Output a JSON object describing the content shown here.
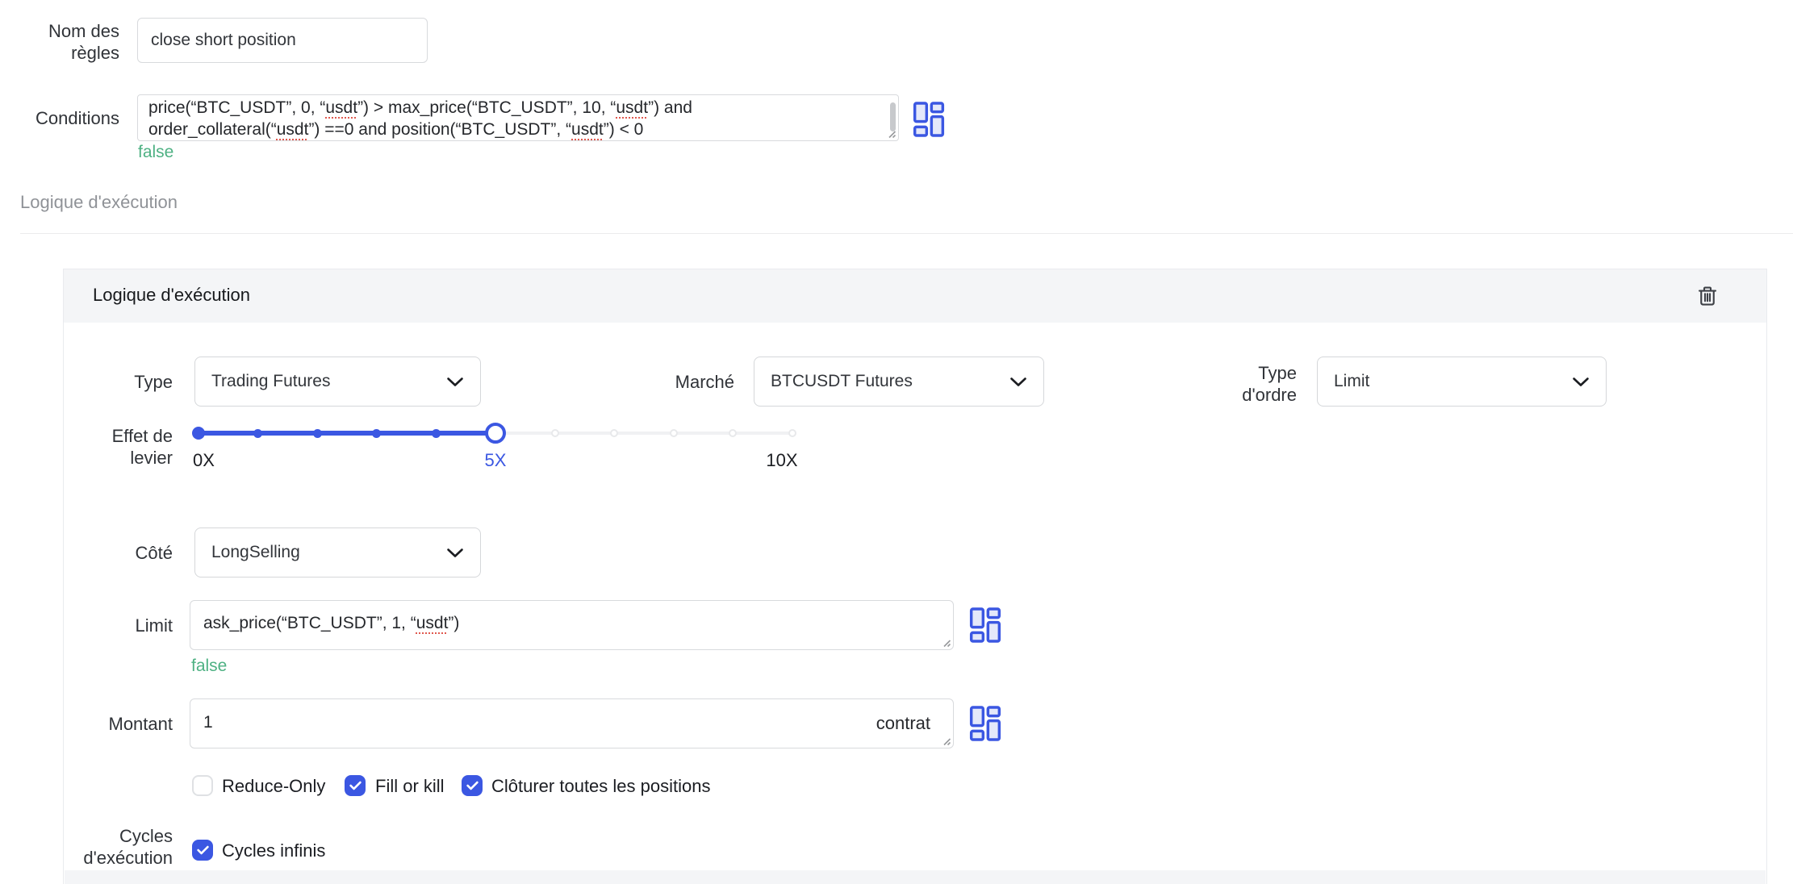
{
  "colors": {
    "accent": "#3b57e2",
    "success": "#4eb183",
    "spell_error": "#e0584e"
  },
  "rule_name": {
    "label": "Nom des règles",
    "value": "close short position"
  },
  "conditions": {
    "label": "Conditions",
    "result": "false",
    "line1": {
      "s0": "price(“BTC_USDT”, 0, “",
      "u0": "usdt",
      "s1": "”) > max_price(“BTC_USDT”, 10, “",
      "u1": "usdt",
      "s2": "”) and"
    },
    "line2": {
      "s0": "order_collateral(“",
      "u0": "usdt",
      "s1": "”) ==0 and position(“BTC_USDT”, “",
      "u1": "usdt",
      "s2": "”) < 0"
    }
  },
  "section_heading": "Logique d'exécution",
  "card": {
    "title": "Logique d'exécution",
    "type": {
      "label": "Type",
      "value": "Trading Futures"
    },
    "market": {
      "label": "Marché",
      "value": "BTCUSDT Futures"
    },
    "order_type": {
      "label": "Type d'ordre",
      "value": "Limit"
    },
    "leverage": {
      "label": "Effet de levier",
      "min": "0X",
      "current": "5X",
      "max": "10X"
    },
    "side": {
      "label": "Côté",
      "value": "LongSelling"
    },
    "limit": {
      "label": "Limit",
      "result": "false",
      "line": {
        "s0": "ask_price(“BTC_USDT”, 1, “",
        "u0": "usdt",
        "s1": "”)"
      }
    },
    "amount": {
      "label": "Montant",
      "value": "1",
      "suffix": "contrat"
    },
    "options": {
      "reduce_only": {
        "label": "Reduce-Only",
        "checked": false
      },
      "fill_or_kill": {
        "label": "Fill or kill",
        "checked": true
      },
      "close_all": {
        "label": "Clôturer toutes les positions",
        "checked": true
      }
    },
    "cycles": {
      "label": "Cycles d'exécution",
      "infinite": {
        "label": "Cycles infinis",
        "checked": true
      }
    }
  }
}
